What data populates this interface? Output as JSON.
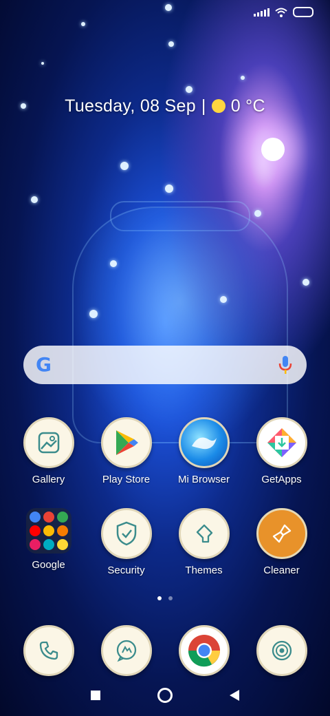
{
  "date_widget": {
    "date": "Tuesday, 08 Sep",
    "separator": "|",
    "temperature": "0 °C"
  },
  "search": {
    "logo": "G",
    "mic": "mic-icon"
  },
  "apps_row1": [
    {
      "label": "Gallery",
      "icon": "gallery-icon"
    },
    {
      "label": "Play Store",
      "icon": "play-store-icon"
    },
    {
      "label": "Mi Browser",
      "icon": "mi-browser-icon"
    },
    {
      "label": "GetApps",
      "icon": "getapps-icon"
    }
  ],
  "apps_row2": [
    {
      "label": "Google",
      "icon": "google-folder"
    },
    {
      "label": "Security",
      "icon": "shield-icon"
    },
    {
      "label": "Themes",
      "icon": "themes-icon"
    },
    {
      "label": "Cleaner",
      "icon": "brush-icon"
    }
  ],
  "dock": [
    {
      "icon": "phone-icon"
    },
    {
      "icon": "messages-icon"
    },
    {
      "icon": "chrome-icon"
    },
    {
      "icon": "camera-icon"
    }
  ],
  "page_indicator": {
    "pages": 2,
    "current": 1
  },
  "colors": {
    "accent_sun": "#ffd640",
    "cleaner_orange": "#e8922a",
    "icon_bg": "#fbf6e6"
  }
}
